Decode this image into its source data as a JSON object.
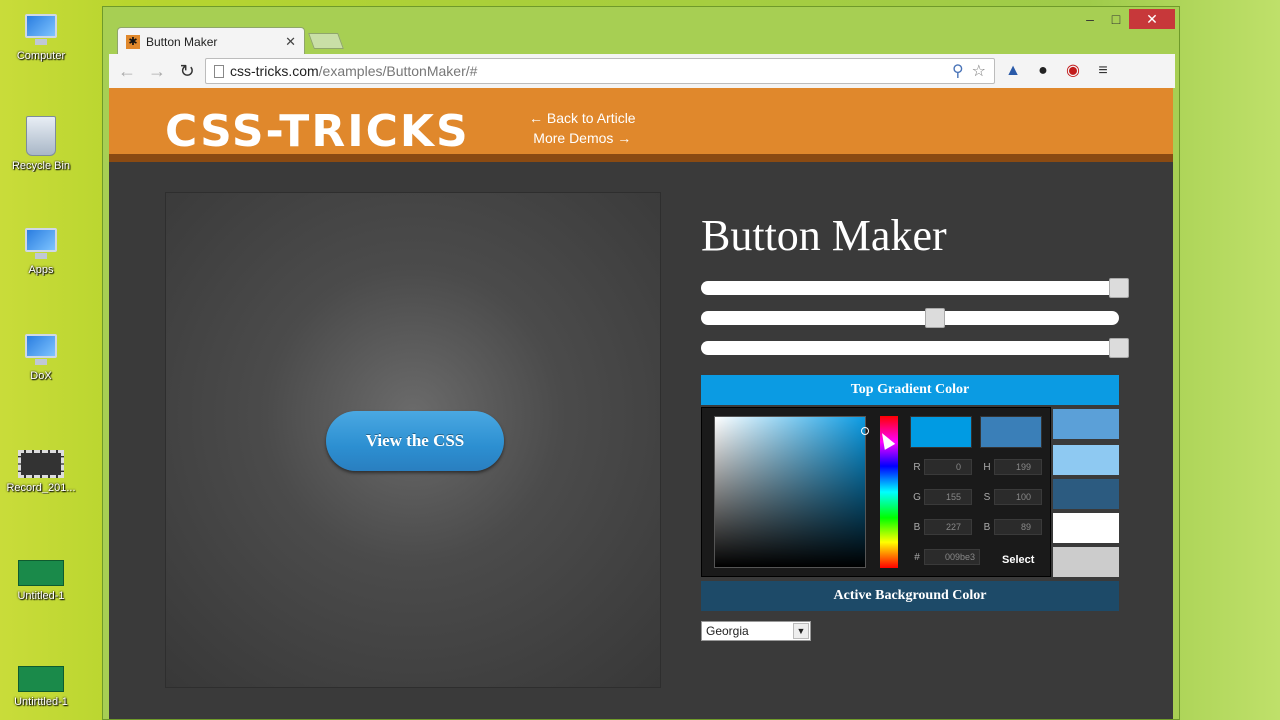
{
  "desktop": {
    "icons": [
      {
        "label": "Computer"
      },
      {
        "label": "Recycle Bin"
      },
      {
        "label": "Apps"
      },
      {
        "label": "DoX"
      },
      {
        "label": "Record_201..."
      },
      {
        "label": "Untitled-1"
      },
      {
        "label": "Untirttled-1"
      }
    ]
  },
  "browser": {
    "window_controls": {
      "minimize": "–",
      "maximize": "□",
      "close": "✕"
    },
    "tab": {
      "title": "Button Maker",
      "favicon": "✱",
      "close": "✕"
    },
    "toolbar": {
      "back": "←",
      "forward": "→",
      "reload": "↻"
    },
    "address": {
      "host": "css-tricks.com",
      "path": "/examples/ButtonMaker/#"
    }
  },
  "site": {
    "logo": "CSS-TRICKS",
    "back_link": "← Back to Article",
    "more_link": "More Demos →"
  },
  "preview": {
    "button_label": "View the CSS",
    "button_color": "#2c8fd1"
  },
  "controls": {
    "title": "Button Maker",
    "sliders": [
      1.0,
      0.56,
      1.0
    ],
    "top_gradient_header": "Top Gradient Color",
    "active_bg_header": "Active Background Color",
    "font_select": "Georgia",
    "swatches": [
      "#5ba0d8",
      "#8ec9f2",
      "#2c5b80",
      "#ffffff",
      "#cccccc"
    ]
  },
  "picker": {
    "new_color": "#009be3",
    "old_color": "#3a7fb8",
    "r_label": "R",
    "r_value": "0",
    "g_label": "G",
    "g_value": "155",
    "b_label": "B",
    "b_value": "227",
    "h_label": "H",
    "h_value": "199",
    "s_label": "S",
    "s_value": "100",
    "bb_label": "B",
    "bb_value": "89",
    "hex_label": "#",
    "hex_value": "009be3",
    "select_label": "Select"
  }
}
